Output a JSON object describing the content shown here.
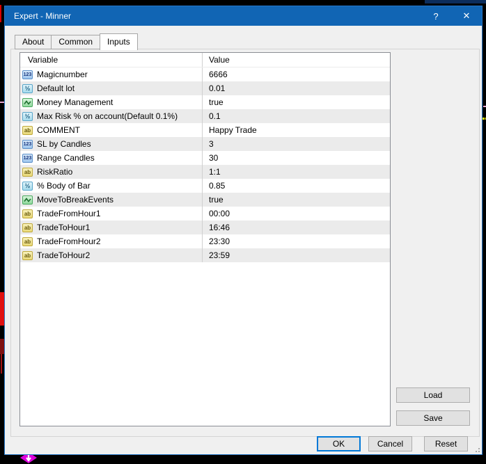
{
  "window": {
    "title": "Expert - Minner",
    "help_glyph": "?",
    "close_glyph": "✕"
  },
  "tabs": {
    "items": [
      {
        "label": "About",
        "active": false
      },
      {
        "label": "Common",
        "active": false
      },
      {
        "label": "Inputs",
        "active": true
      }
    ]
  },
  "table": {
    "columns": [
      "Variable",
      "Value"
    ],
    "icon_glyphs": {
      "int": "123",
      "double": "½",
      "string": "ab"
    },
    "rows": [
      {
        "icon": "int",
        "variable": "Magicnumber",
        "value": "6666"
      },
      {
        "icon": "double",
        "variable": "Default lot",
        "value": "0.01"
      },
      {
        "icon": "bool",
        "variable": "Money Management",
        "value": "true"
      },
      {
        "icon": "double",
        "variable": "Max Risk % on account(Default 0.1%)",
        "value": "0.1"
      },
      {
        "icon": "string",
        "variable": "COMMENT",
        "value": "Happy Trade"
      },
      {
        "icon": "int",
        "variable": "SL by Candles",
        "value": "3"
      },
      {
        "icon": "int",
        "variable": "Range Candles",
        "value": "30"
      },
      {
        "icon": "string",
        "variable": "RiskRatio",
        "value": "1:1"
      },
      {
        "icon": "double",
        "variable": "% Body of Bar",
        "value": "0.85"
      },
      {
        "icon": "bool",
        "variable": "MoveToBreakEvents",
        "value": "true"
      },
      {
        "icon": "string",
        "variable": "TradeFromHour1",
        "value": "00:00"
      },
      {
        "icon": "string",
        "variable": "TradeToHour1",
        "value": "16:46"
      },
      {
        "icon": "string",
        "variable": "TradeFromHour2",
        "value": "23:30"
      },
      {
        "icon": "string",
        "variable": "TradeToHour2",
        "value": "23:59"
      }
    ]
  },
  "buttons": {
    "load": "Load",
    "save": "Save",
    "ok": "OK",
    "cancel": "Cancel",
    "reset": "Reset"
  },
  "colors": {
    "titlebar": "#1165b4",
    "accent": "#0078d7",
    "dialog_bg": "#f0f0f0",
    "row_alt": "#ebebeb",
    "marker_magenta": "#dd00dd",
    "candle_red": "#e01010",
    "line_pink": "#eba8d3",
    "dot_yellow": "#e8e800"
  }
}
